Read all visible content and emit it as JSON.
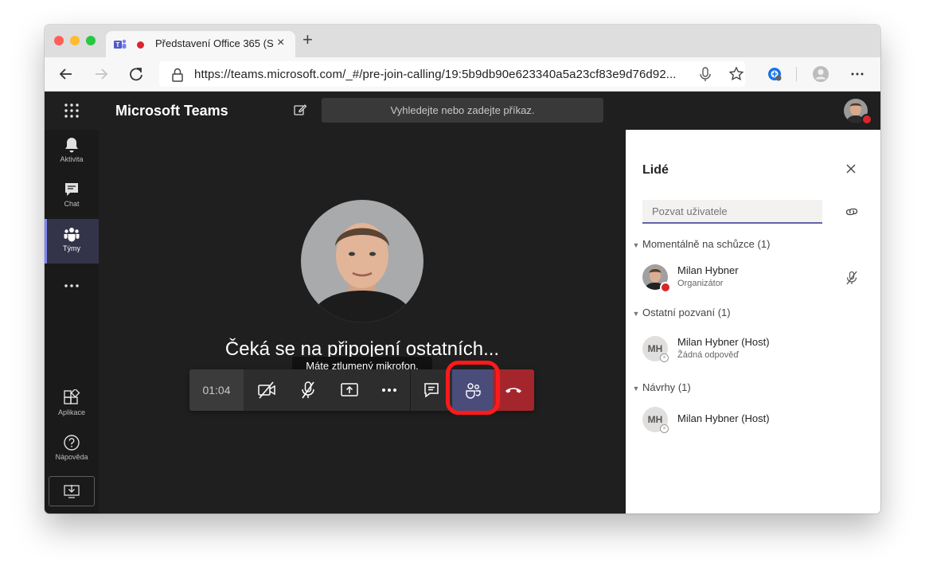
{
  "browser": {
    "tab_title": "Představení Office 365 (S",
    "tab_close": "×",
    "new_tab": "+",
    "url": "https://teams.microsoft.com/_#/pre-join-calling/19:5b9db90e623340a5a23cf83e9d76d92..."
  },
  "teams": {
    "app_name": "Microsoft Teams",
    "search_placeholder": "Vyhledejte nebo zadejte příkaz."
  },
  "rail": {
    "items": [
      {
        "label": "Aktivita",
        "icon": "bell-icon"
      },
      {
        "label": "Chat",
        "icon": "chat-icon"
      },
      {
        "label": "Týmy",
        "icon": "teams-icon",
        "active": true
      },
      {
        "label": "",
        "icon": "more-icon"
      },
      {
        "label": "Aplikace",
        "icon": "apps-icon"
      },
      {
        "label": "Nápověda",
        "icon": "help-icon"
      }
    ]
  },
  "stage": {
    "waiting_text": "Čeká se na připojení ostatních...",
    "tooltip": "Máte ztlumený mikrofon.",
    "timer": "01:04"
  },
  "panel": {
    "title": "Lidé",
    "invite_placeholder": "Pozvat uživatele",
    "sections": [
      {
        "title": "Momentálně na schůzce",
        "count": "(1)"
      },
      {
        "title": "Ostatní pozvaní",
        "count": "(1)"
      },
      {
        "title": "Návrhy",
        "count": "(1)"
      }
    ],
    "people": [
      {
        "name": "Milan Hybner",
        "sub": "Organizátor",
        "initials": ""
      },
      {
        "name": "Milan Hybner (Host)",
        "sub": "Žádná odpověď",
        "initials": "MH"
      },
      {
        "name": "Milan Hybner (Host)",
        "sub": "",
        "initials": "MH"
      }
    ]
  },
  "colors": {
    "accent": "#6264a7",
    "hangup": "#a4262c",
    "highlight": "#ff1a1a",
    "dark_bg": "#1f1f1f"
  }
}
